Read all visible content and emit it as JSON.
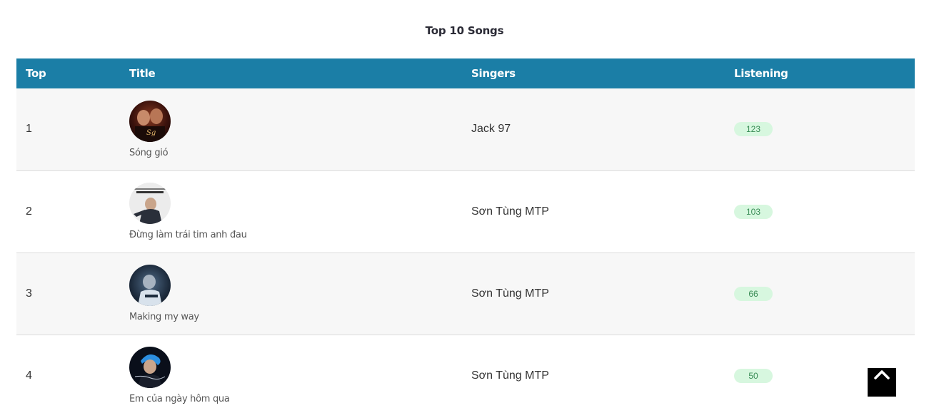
{
  "page": {
    "title": "Top 10 Songs"
  },
  "table": {
    "headers": {
      "top": "Top",
      "title": "Title",
      "singers": "Singers",
      "listening": "Listening"
    },
    "rows": [
      {
        "rank": "1",
        "title": "Sóng gió",
        "singer": "Jack 97",
        "listening": "123",
        "cover_icon": "album-cover-image"
      },
      {
        "rank": "2",
        "title": "Đừng làm trái tim anh đau",
        "singer": "Sơn Tùng MTP",
        "listening": "103",
        "cover_icon": "album-cover-image"
      },
      {
        "rank": "3",
        "title": "Making my way",
        "singer": "Sơn Tùng MTP",
        "listening": "66",
        "cover_icon": "album-cover-image"
      },
      {
        "rank": "4",
        "title": "Em của ngày hôm qua",
        "singer": "Sơn Tùng MTP",
        "listening": "50",
        "cover_icon": "album-cover-image"
      }
    ]
  },
  "colors": {
    "header_bg": "#1b7ea6",
    "badge_bg": "#d7f7df",
    "badge_text": "#3b8d57",
    "back_to_top_bg": "#000000"
  },
  "controls": {
    "back_to_top_icon": "chevron-up-icon"
  }
}
